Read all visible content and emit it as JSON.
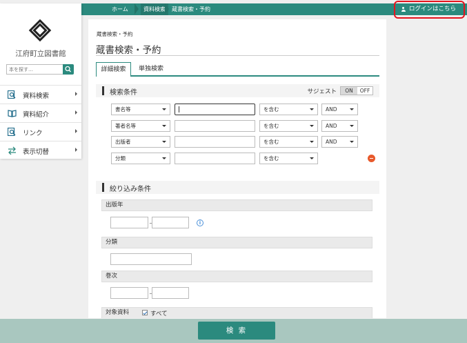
{
  "breadcrumb": [
    "ホーム",
    "資料検索",
    "蔵書検索・予約"
  ],
  "login_label": "ログインはこちら",
  "library_name": "江府町立図書館",
  "search": {
    "placeholder": "本を探す…"
  },
  "nav": [
    {
      "label": "資料検索",
      "icon": "search-book-icon"
    },
    {
      "label": "資料紹介",
      "icon": "open-book-icon"
    },
    {
      "label": "リンク",
      "icon": "link-search-icon"
    },
    {
      "label": "表示切替",
      "icon": "switch-arrows-icon"
    }
  ],
  "main": {
    "small_crumb": "蔵書検索・予約",
    "title": "蔵書検索・予約",
    "tabs": [
      "詳細検索",
      "単独検索"
    ]
  },
  "conditions": {
    "heading": "検索条件",
    "suggest_label": "サジェスト",
    "toggle_on": "ON",
    "toggle_off": "OFF",
    "rows": [
      {
        "field": "書名等",
        "match": "を含む",
        "op": "AND"
      },
      {
        "field": "著者名等",
        "match": "を含む",
        "op": "AND"
      },
      {
        "field": "出版者",
        "match": "を含む",
        "op": "AND"
      },
      {
        "field": "分類",
        "match": "を含む",
        "op": ""
      }
    ]
  },
  "refine": {
    "heading": "絞り込み条件",
    "year_label": "出版年",
    "class_label": "分類",
    "volume_label": "巻次",
    "target_label": "対象資料",
    "target_all": "すべて",
    "tilde": "~"
  },
  "submit_label": "検 索",
  "colors": {
    "accent": "#2b8a7e",
    "highlight": "#e5131d",
    "remove": "#e8592b"
  }
}
